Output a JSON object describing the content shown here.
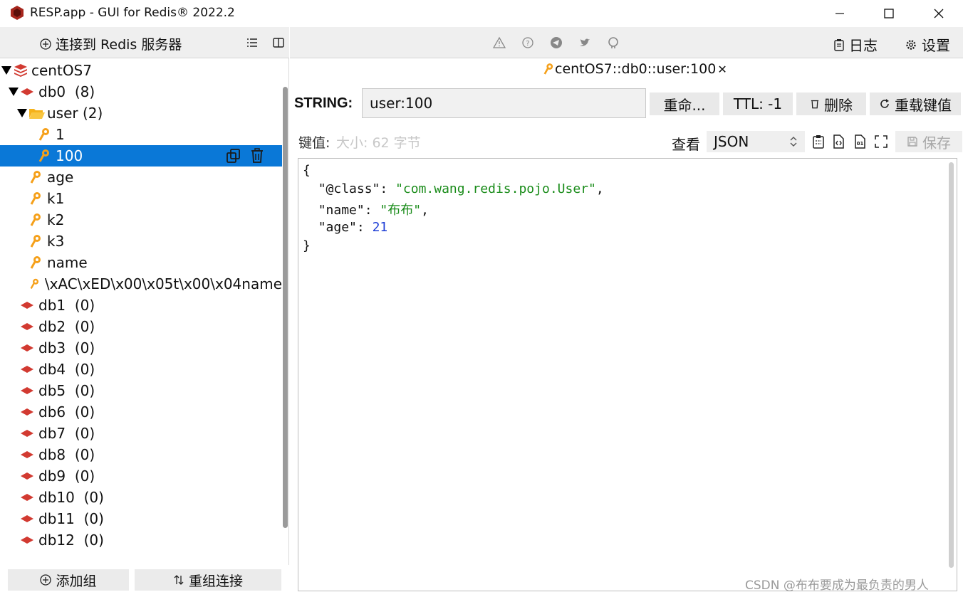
{
  "window": {
    "title": "RESP.app - GUI for Redis® 2022.2",
    "minimize": "—",
    "maximize": "☐",
    "close": "✕"
  },
  "left_toolbar": {
    "connect_label": "连接到 Redis 服务器"
  },
  "tree": {
    "server": "centOS7",
    "db0": {
      "name": "db0",
      "count": "(8)"
    },
    "folder": {
      "name": "user",
      "count": "(2)"
    },
    "folder_keys": [
      "1",
      "100"
    ],
    "keys": [
      "age",
      "k1",
      "k2",
      "k3",
      "name",
      "\\xAC\\xED\\x00\\x05t\\x00\\x04name"
    ],
    "dbs": [
      {
        "name": "db1",
        "count": "(0)"
      },
      {
        "name": "db2",
        "count": "(0)"
      },
      {
        "name": "db3",
        "count": "(0)"
      },
      {
        "name": "db4",
        "count": "(0)"
      },
      {
        "name": "db5",
        "count": "(0)"
      },
      {
        "name": "db6",
        "count": "(0)"
      },
      {
        "name": "db7",
        "count": "(0)"
      },
      {
        "name": "db8",
        "count": "(0)"
      },
      {
        "name": "db9",
        "count": "(0)"
      },
      {
        "name": "db10",
        "count": "(0)"
      },
      {
        "name": "db11",
        "count": "(0)"
      },
      {
        "name": "db12",
        "count": "(0)"
      }
    ]
  },
  "left_bottom": {
    "add_group": "添加组",
    "regroup": "重组连接"
  },
  "right_toolbar": {
    "log": "日志",
    "settings": "设置"
  },
  "tab": {
    "label": "centOS7::db0::user:100",
    "close": "✕"
  },
  "key_editor": {
    "type_label": "STRING:",
    "key_name": "user:100",
    "rename": "重命...",
    "ttl": "TTL:  -1",
    "delete": "删除",
    "reload": "重载键值"
  },
  "value_bar": {
    "value_label": "键值:",
    "size": "大小: 62 字节",
    "view_label": "查看",
    "view_format": "JSON",
    "save": "保存"
  },
  "editor": {
    "line1": "{",
    "l2_key": "\"@class\"",
    "l2_val": "\"com.wang.redis.pojo.User\"",
    "l3_key": "\"name\"",
    "l3_val": "\"布布\"",
    "l4_key": "\"age\"",
    "l4_val": "21",
    "line5": "}"
  },
  "watermark": "CSDN @布布要成为最负责的男人",
  "colors": {
    "selection": "#0a78d7",
    "key_icon": "#f5a01a",
    "db_icon": "#d23a31",
    "json_string": "#1a8c1a",
    "json_number": "#1f3fd6"
  }
}
